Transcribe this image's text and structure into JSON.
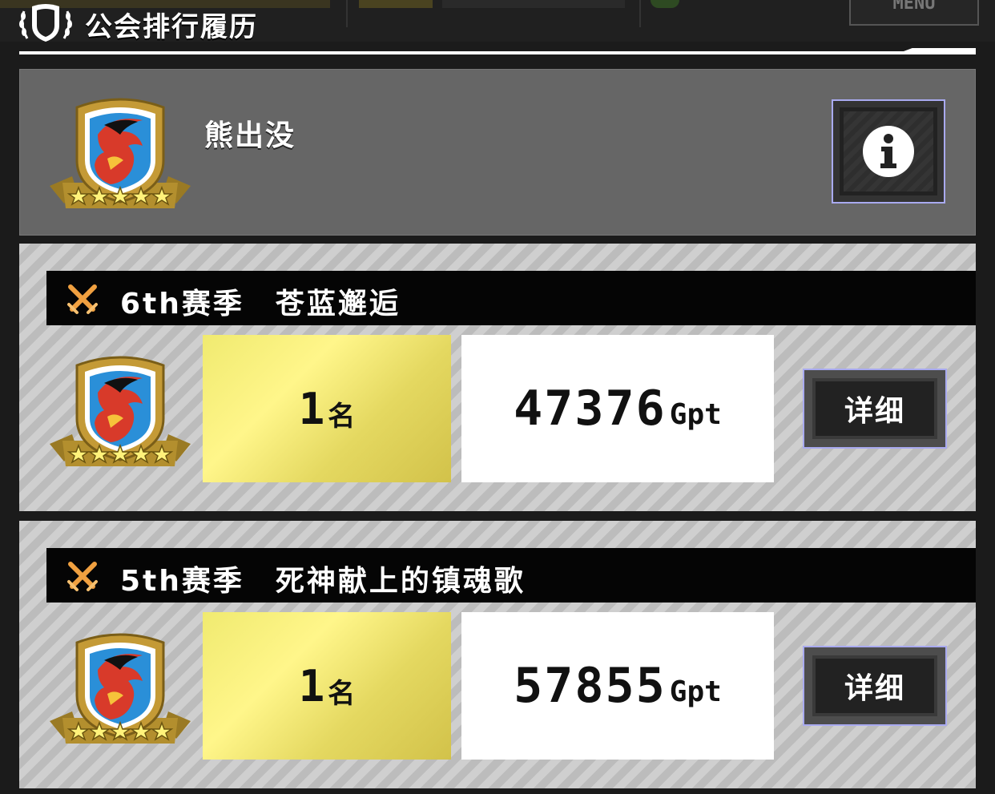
{
  "header": {
    "title": "公会排行履历",
    "background_menu_label": "MENU",
    "icon": "shield-laurel-icon"
  },
  "guild": {
    "name": "熊出没",
    "emblem": "dragon-shield-emblem",
    "stars": 5,
    "info_icon": "info-icon"
  },
  "seasons": [
    {
      "title": "6th赛季　苍蓝邂逅",
      "rank_number": "1",
      "rank_unit": "名",
      "score": "47376",
      "score_unit": "Gpt",
      "detail_label": "详细",
      "icon": "crossed-swords-icon"
    },
    {
      "title": "5th赛季　死神献上的镇魂歌",
      "rank_number": "1",
      "rank_unit": "名",
      "score": "57855",
      "score_unit": "Gpt",
      "detail_label": "详细",
      "icon": "crossed-swords-icon"
    }
  ],
  "colors": {
    "accent_border": "#a9aaf0",
    "rank_gold": "#f0ea70",
    "swords_orange": "#f0a040",
    "emblem_gold": "#b08a2a",
    "emblem_blue": "#2a8fd8",
    "emblem_red": "#d83a2a"
  }
}
